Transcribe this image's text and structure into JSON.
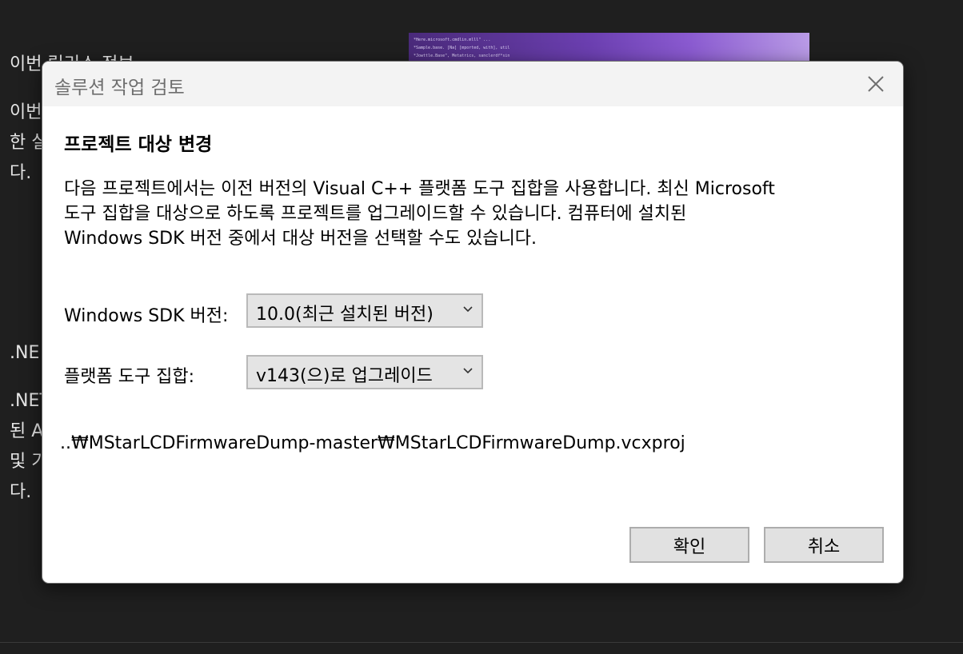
{
  "background": {
    "section1_title": "이번 릴리스 정보",
    "section1_body": "이번\n한 실\n다.",
    "section2_title": ".NE",
    "section2_body": ".NET\n된 A\n및 기\n다.",
    "banner_code": "*Here.microsoft.cmdlin.mlll\" ...\n*Sample.base. [Na] [mported, with], util\n*Jowttle.Base\", Metatrics, sanclerdf*sin"
  },
  "dialog": {
    "title": "솔루션 작업 검토",
    "heading": "프로젝트 대상 변경",
    "description": [
      "다음 프로젝트에서는 이전 버전의 Visual C++ 플랫폼 도구 집합을 사용합니다. 최신 Microsoft",
      "도구 집합을 대상으로 하도록 프로젝트를 업그레이드할 수 있습니다. 컴퓨터에 설치된",
      "Windows SDK 버전 중에서 대상 버전을 선택할 수도 있습니다."
    ],
    "sdk_label": "Windows SDK 버전:",
    "sdk_value": "10.0(최근 설치된 버전)",
    "toolset_label": "플랫폼 도구 집합:",
    "toolset_value": "v143(으)로 업그레이드",
    "project_path": "..₩MStarLCDFirmwareDump-master₩MStarLCDFirmwareDump.vcxproj",
    "ok_label": "확인",
    "cancel_label": "취소"
  },
  "icons": {
    "close": "close-icon",
    "dropdown": "chevron-down-icon"
  }
}
